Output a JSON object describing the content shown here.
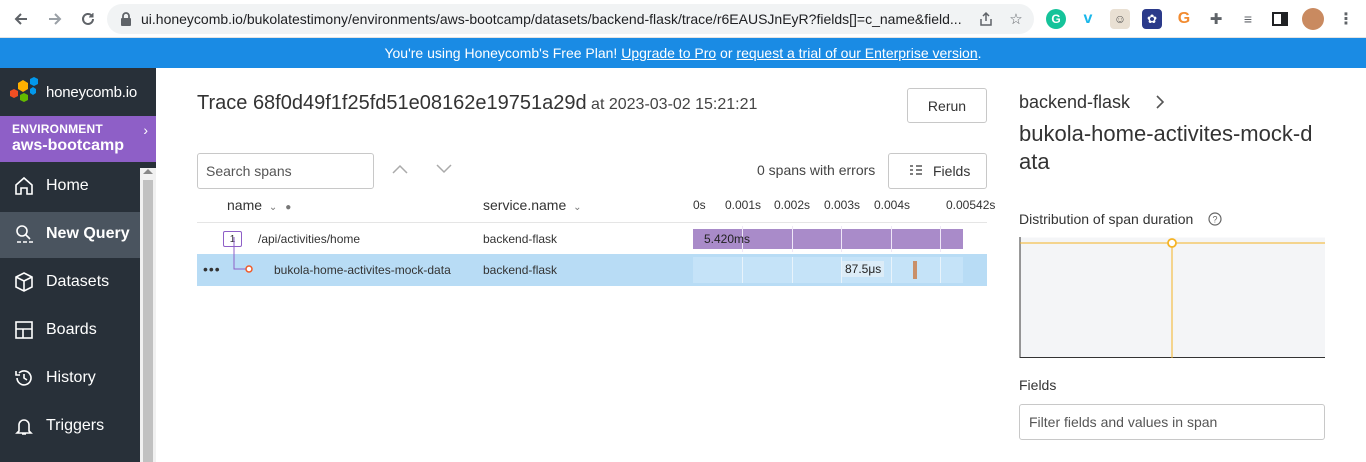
{
  "browser": {
    "url": "ui.honeycomb.io/bukolatestimony/environments/aws-bootcamp/datasets/backend-flask/trace/r6EAUSJnEyR?fields[]=c_name&field..."
  },
  "banner": {
    "prefix": "You're using Honeycomb's Free Plan! ",
    "upgrade_link": "Upgrade to Pro",
    "middle": " or ",
    "trial_link": "request a trial of our Enterprise version",
    "suffix": "."
  },
  "sidebar": {
    "brand": "honeycomb.io",
    "env_label": "ENVIRONMENT",
    "env_name": "aws-bootcamp",
    "items": [
      {
        "label": "Home",
        "icon": "home-icon"
      },
      {
        "label": "New Query",
        "icon": "query-icon",
        "active": true
      },
      {
        "label": "Datasets",
        "icon": "cube-icon"
      },
      {
        "label": "Boards",
        "icon": "boards-icon"
      },
      {
        "label": "History",
        "icon": "history-icon"
      },
      {
        "label": "Triggers",
        "icon": "bell-icon"
      }
    ]
  },
  "trace": {
    "title_prefix": "Trace ",
    "trace_id": "68f0d49f1f25fd51e08162e19751a29d",
    "at_text": " at 2023-03-02 15:21:21",
    "rerun_label": "Rerun",
    "search_placeholder": "Search spans",
    "errors_text": "0 spans with errors",
    "fields_label": "Fields",
    "columns": {
      "name": "name",
      "service": "service.name"
    },
    "ticks": [
      "0s",
      "0.001s",
      "0.002s",
      "0.003s",
      "0.004s",
      "0.00542s"
    ],
    "rows": [
      {
        "badge": "1",
        "name": "/api/activities/home",
        "service": "backend-flask",
        "duration": "5.420ms"
      },
      {
        "name": "bukola-home-activites-mock-data",
        "service": "backend-flask",
        "duration": "87.5μs"
      }
    ]
  },
  "details": {
    "service": "backend-flask",
    "span_name": "bukola-home-activites-mock-data",
    "distribution_label": "Distribution of span duration",
    "fields_label": "Fields",
    "filter_placeholder": "Filter fields and values in span"
  },
  "colors": {
    "banner": "#1a8be4",
    "sidebar": "#283039",
    "env": "#8e5fc7",
    "root_bar": "#a98bc9",
    "selected_row": "#b8dcf5",
    "child_bar": "#c9906a",
    "chart_line": "#f5b325"
  }
}
